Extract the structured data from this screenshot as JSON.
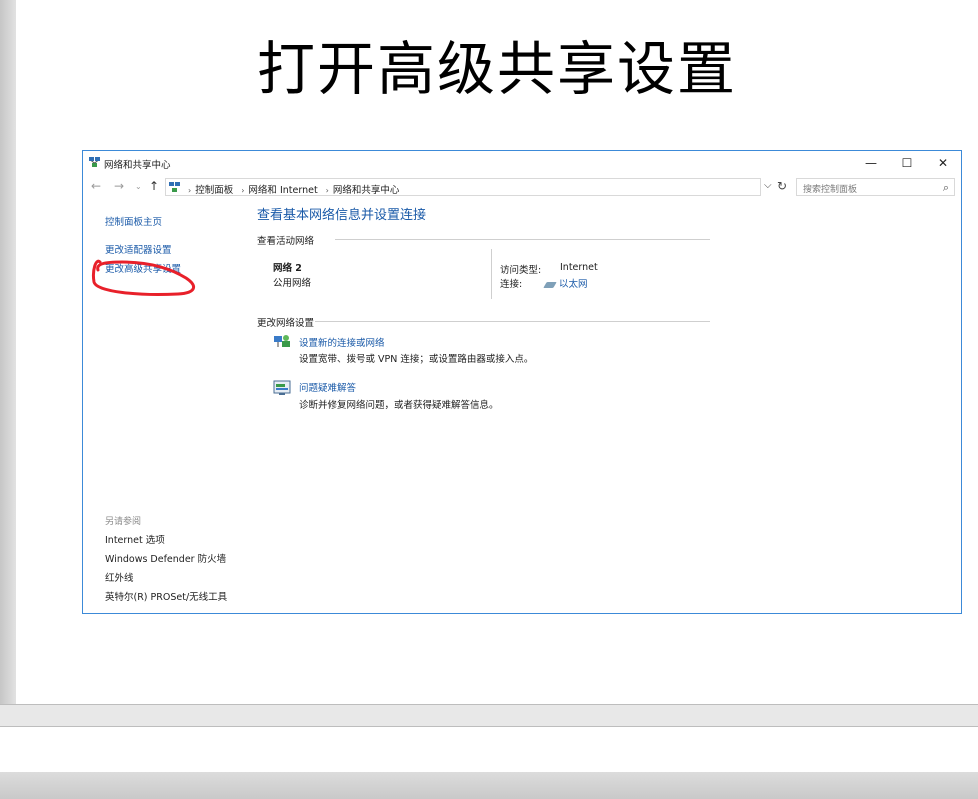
{
  "slide": {
    "title": "打开高级共享设置"
  },
  "window": {
    "title": "网络和共享中心",
    "controls": {
      "minimize": "—",
      "maximize": "☐",
      "close": "✕"
    },
    "nav": {
      "back": "←",
      "forward": "→",
      "dropdown": "⌄",
      "up": "↑"
    },
    "breadcrumb": [
      "控制面板",
      "网络和 Internet",
      "网络和共享中心"
    ],
    "search_placeholder": "搜索控制面板"
  },
  "sidebar": {
    "home": "控制面板主页",
    "adapter": "更改适配器设置",
    "advanced_sharing": "更改高级共享设置",
    "see_also_heading": "另请参阅",
    "see_also": [
      "Internet 选项",
      "Windows Defender 防火墙",
      "红外线",
      "英特尔(R) PROSet/无线工具"
    ]
  },
  "main": {
    "heading": "查看基本网络信息并设置连接",
    "active_networks_heading": "查看活动网络",
    "network_name": "网络 2",
    "network_type": "公用网络",
    "access_type_label": "访问类型:",
    "access_type_value": "Internet",
    "connection_label": "连接:",
    "connection_value": "以太网",
    "change_settings_heading": "更改网络设置",
    "tasks": [
      {
        "link": "设置新的连接或网络",
        "desc": "设置宽带、拨号或 VPN 连接；或设置路由器或接入点。"
      },
      {
        "link": "问题疑难解答",
        "desc": "诊断并修复网络问题，或者获得疑难解答信息。"
      }
    ]
  },
  "colors": {
    "link": "#1a5aa8",
    "window_border": "#3c8ad8",
    "annotation": "#e8202a"
  }
}
